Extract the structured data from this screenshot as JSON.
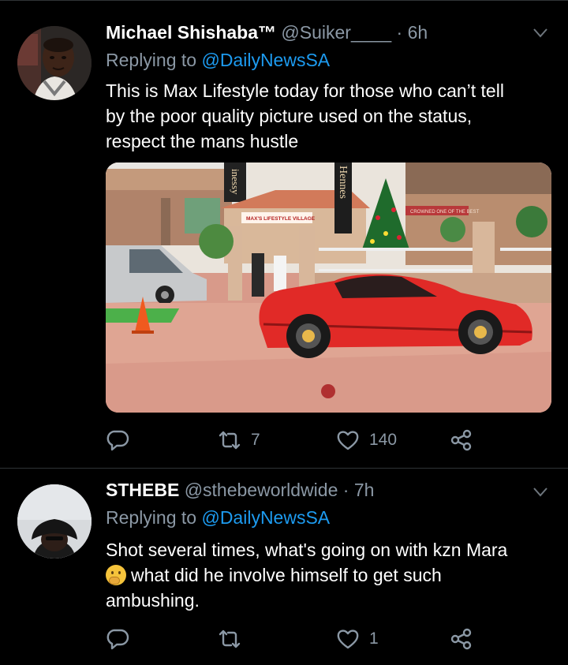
{
  "tweets": [
    {
      "display_name": "Michael Shishaba™",
      "handle": "@Suiker____",
      "separator": "·",
      "time": "6h",
      "replying_label": "Replying to",
      "replying_to": "@DailyNewsSA",
      "text_lines": [
        "This is Max Lifestyle today for those who can’t tell",
        "by the poor quality picture used on the status,",
        "respect the mans hustle"
      ],
      "media": {
        "signs": {
          "hennessy_left": "inessy",
          "hennessy_right": "Hennes",
          "village": "MAX'S LIFESTYLE VILLAGE",
          "banner": "CROWNED ONE OF THE BEST"
        }
      },
      "reply_count": "",
      "retweet_count": "7",
      "like_count": "140"
    },
    {
      "display_name": "STHEBE",
      "handle": "@sthebeworldwide",
      "separator": "·",
      "time": "7h",
      "replying_label": "Replying to",
      "replying_to": "@DailyNewsSA",
      "text_lines": [
        "Shot several times, what's going on with kzn Mara",
        "what did he involve himself to get such",
        "ambushing."
      ],
      "emoji": "thinking-face",
      "reply_count": "",
      "retweet_count": "",
      "like_count": "1"
    }
  ],
  "colors": {
    "background": "#000000",
    "text": "#ffffff",
    "muted": "#8b98a5",
    "link": "#1d9bf0",
    "divider": "#2f3336"
  },
  "icons": [
    "reply-icon",
    "retweet-icon",
    "like-icon",
    "share-icon",
    "chevron-down-icon"
  ]
}
